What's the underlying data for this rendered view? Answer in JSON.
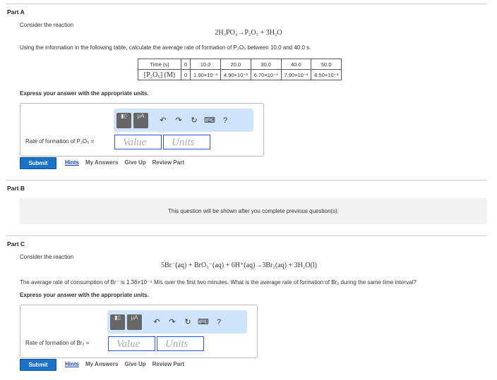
{
  "partA": {
    "label": "Part A",
    "intro": "Consider the reaction",
    "equation": "2H₃PO₄→P₂O₅ + 3H₂O",
    "instruction": "Using the information in the following table, calculate the average rate of formation of P₂O₅ between 10.0 and 40.0 s.",
    "table": {
      "header": [
        "Time (s)",
        "0",
        "10.0",
        "20.0",
        "30.0",
        "40.0",
        "50.0"
      ],
      "row": [
        "[P₂O₅] (M)",
        "0",
        "1.90×10⁻³",
        "4.90×10⁻³",
        "6.70×10⁻³",
        "7.90×10⁻³",
        "8.50×10⁻³"
      ]
    },
    "express": "Express your answer with the appropriate units.",
    "answer_label": "Rate of formation of P₂O₅ =",
    "value_placeholder": "Value",
    "units_placeholder": "Units"
  },
  "partB": {
    "label": "Part B",
    "locked": "This question will be shown after you complete previous question(s)."
  },
  "partC": {
    "label": "Part C",
    "intro": "Consider the reaction",
    "equation": "5Br⁻(aq) + BrO₃⁻(aq) + 6H⁺(aq)→3Br₂(aq) + 3H₂O(l)",
    "instruction": "The average rate of consumption of Br⁻ is 1.36×10⁻⁴ M/s over the first two minutes. What is the average rate of formation of Br₂ during the same time interval?",
    "express": "Express your answer with the appropriate units.",
    "answer_label": "Rate of formation of Br₂ =",
    "value_placeholder": "Value",
    "units_placeholder": "Units"
  },
  "toolbar": {
    "template": "▮▯",
    "units": "μA",
    "undo": "↶",
    "redo": "↷",
    "reset": "↻",
    "keyboard": "⌨",
    "help": "?"
  },
  "actions": {
    "submit": "Submit",
    "hints": "Hints",
    "my_answers": "My Answers",
    "give_up": "Give Up",
    "review": "Review Part"
  }
}
